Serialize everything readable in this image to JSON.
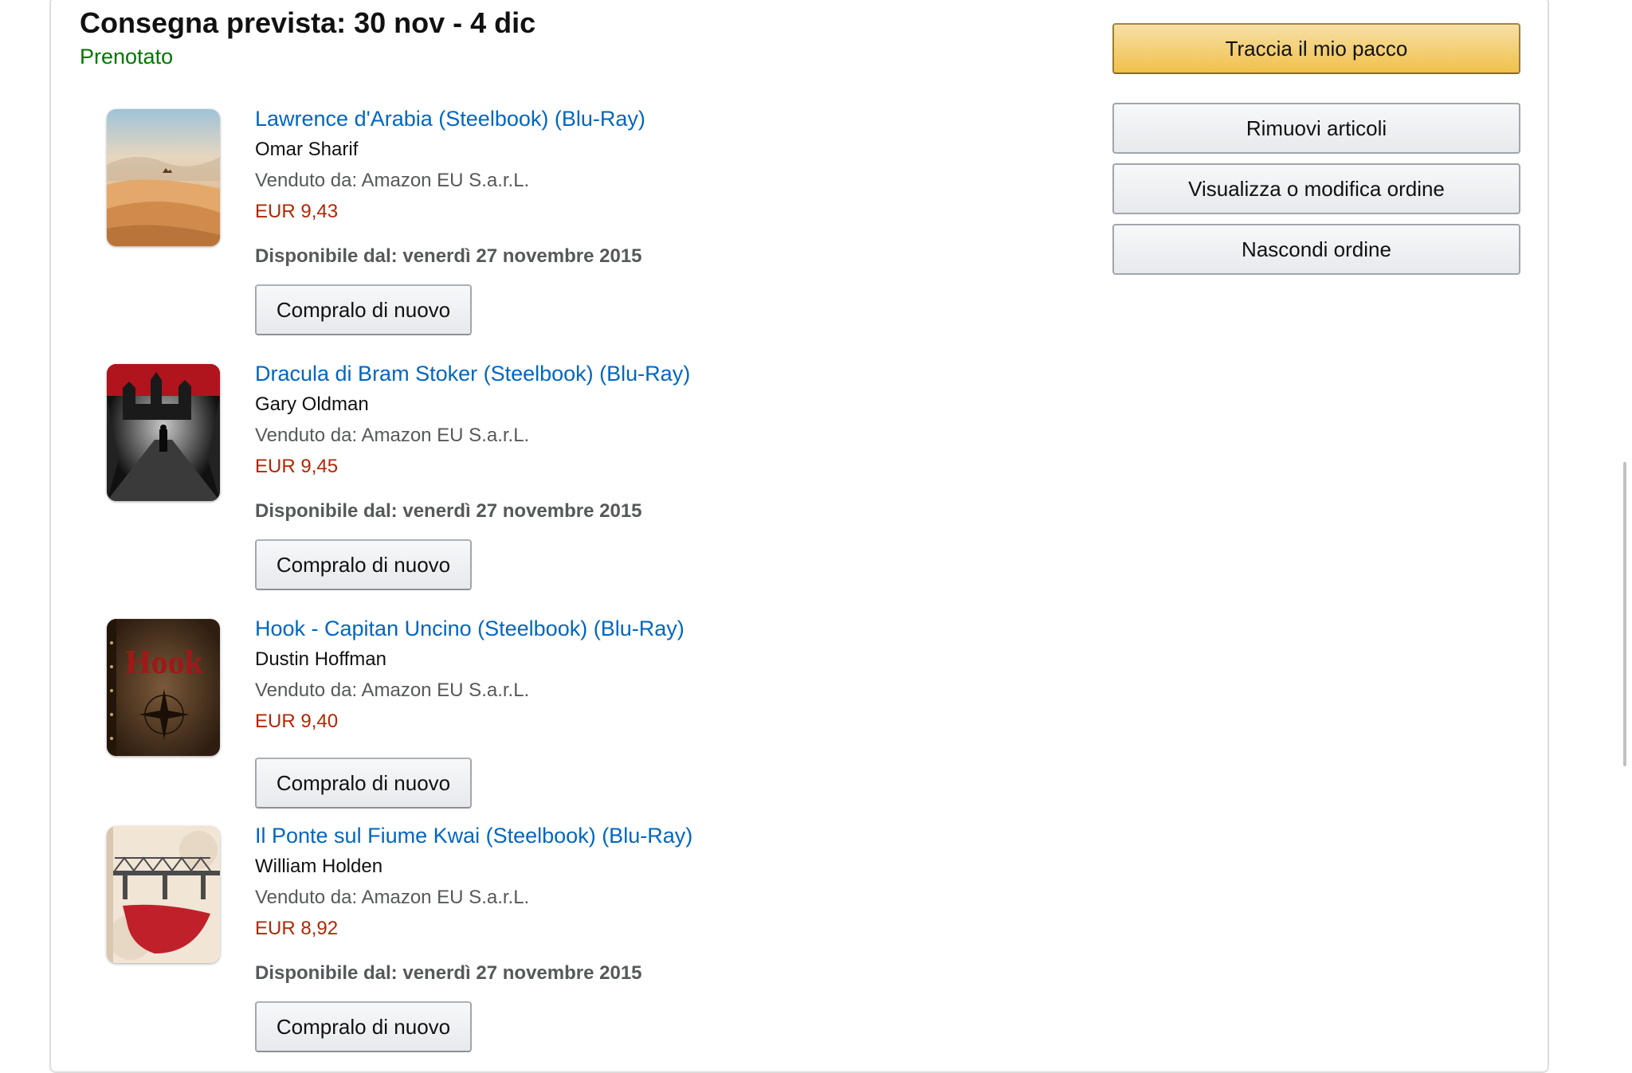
{
  "shipment": {
    "title": "Consegna prevista: 30 nov - 4 dic",
    "status": "Prenotato"
  },
  "actions": {
    "track": "Traccia il mio pacco",
    "remove": "Rimuovi articoli",
    "view_edit": "Visualizza o modifica ordine",
    "hide": "Nascondi ordine"
  },
  "colors": {
    "link": "#0066c0",
    "price": "#b12704",
    "status": "#007600",
    "track_button": "#f0c14b"
  },
  "items": [
    {
      "title": "Lawrence d'Arabia (Steelbook) (Blu-Ray)",
      "author": "Omar Sharif",
      "seller": "Venduto da: Amazon EU S.a.r.L.",
      "price": "EUR 9,43",
      "availability": "Disponibile dal: venerdì 27 novembre 2015",
      "buy_again": "Compralo di nuovo",
      "cover_icon": "desert-cover-icon"
    },
    {
      "title": "Dracula di Bram Stoker (Steelbook) (Blu-Ray)",
      "author": "Gary Oldman",
      "seller": "Venduto da: Amazon EU S.a.r.L.",
      "price": "EUR 9,45",
      "availability": "Disponibile dal: venerdì 27 novembre 2015",
      "buy_again": "Compralo di nuovo",
      "cover_icon": "castle-cover-icon"
    },
    {
      "title": "Hook - Capitan Uncino (Steelbook) (Blu-Ray)",
      "author": "Dustin Hoffman",
      "seller": "Venduto da: Amazon EU S.a.r.L.",
      "price": "EUR 9,40",
      "buy_again": "Compralo di nuovo",
      "cover_text": "Hook",
      "cover_icon": "book-cover-icon"
    },
    {
      "title": "Il Ponte sul Fiume Kwai (Steelbook) (Blu-Ray)",
      "author": "William Holden",
      "seller": "Venduto da: Amazon EU S.a.r.L.",
      "price": "EUR 8,92",
      "availability": "Disponibile dal: venerdì 27 novembre 2015",
      "buy_again": "Compralo di nuovo",
      "cover_icon": "bridge-cover-icon"
    }
  ]
}
